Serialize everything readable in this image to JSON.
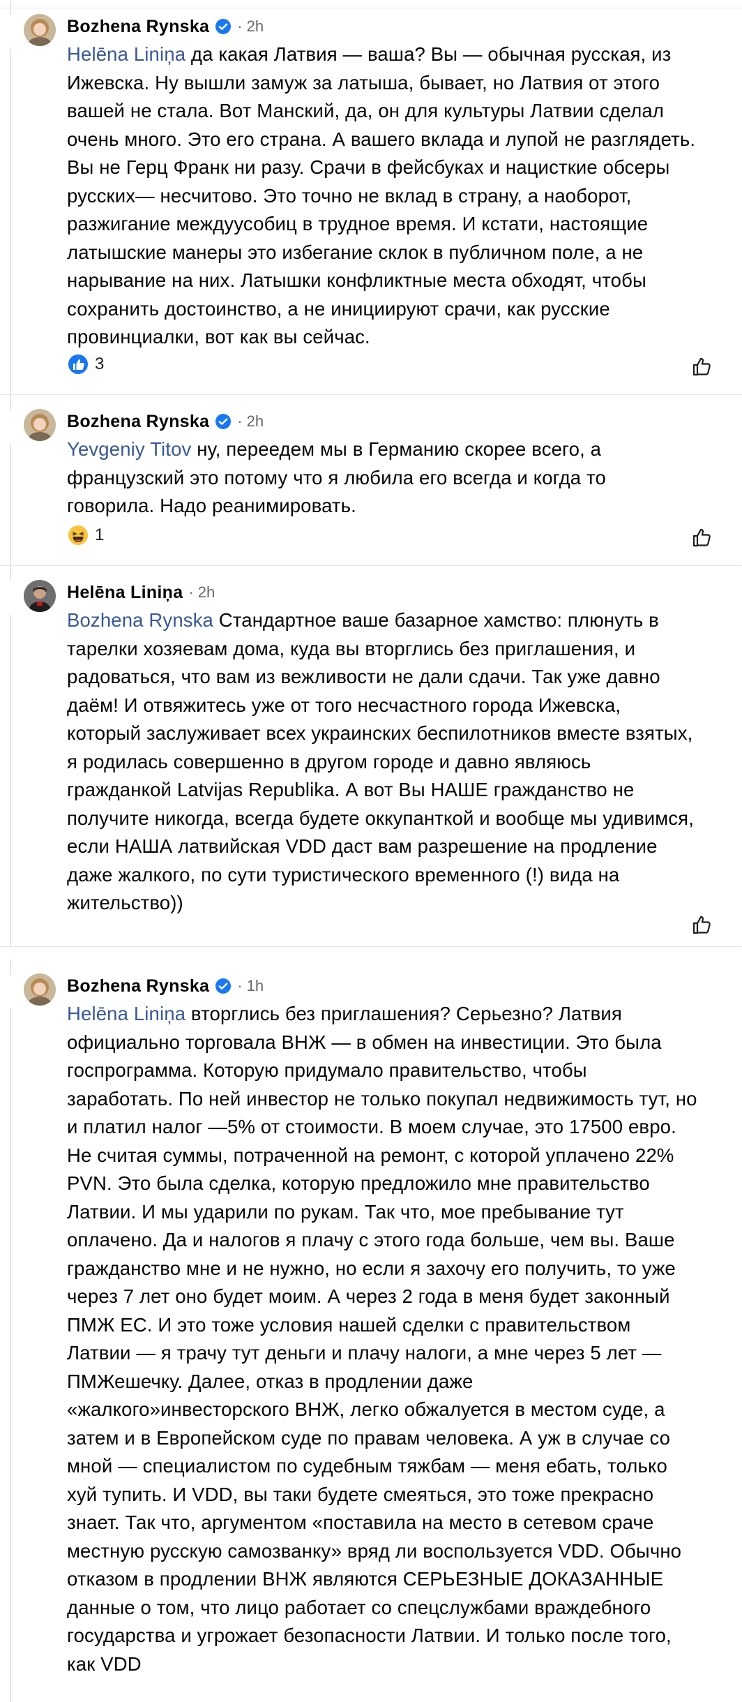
{
  "comments": [
    {
      "author": "Bozhena  Rynska",
      "verified": true,
      "separator": "·",
      "time": "2h",
      "mention": "Helēna Liniņa",
      "text": " да какая Латвия — ваша? Вы — обычная русская, из Ижевска. Ну вышли замуж за латыша, бывает, но Латвия от этого вашей не стала. Вот Манский, да, он для культуры Латвии сделал очень много. Это его страна. А вашего вклада и лупой не разглядеть. Вы не Герц Франк ни разу. Срачи в фейсбуках и нацисткие обсеры русских— несчитово. Это точно не вклад в страну, а наоборот, разжигание междуусобиц в трудное время. И кстати, настоящие латышские манеры это избегание склок в публичном поле, а не нарывание на них. Латышки конфликтные места обходят, чтобы сохранить достоинство, а не инициируют срачи, как русские провинциалки, вот как вы сейчас.",
      "reaction": {
        "icon": "like-reaction-icon",
        "count": "3"
      }
    },
    {
      "author": "Bozhena  Rynska",
      "verified": true,
      "separator": "·",
      "time": "2h",
      "mention": "Yevgeniy Titov",
      "text": " ну, переедем мы в Германию скорее всего, а французский это потому что я любила его всегда и когда то говорила. Надо реанимировать.",
      "reaction": {
        "icon": "haha-reaction-icon",
        "count": "1"
      }
    },
    {
      "author": "Helēna Liniņa",
      "verified": false,
      "separator": "·",
      "time": "2h",
      "mention": "Bozhena  Rynska",
      "text": " Стандартное ваше базарное хамство: плюнуть в тарелки хозяевам дома, куда вы вторглись без приглашения, и радоваться, что вам из вежливости не дали сдачи. Так уже давно даём! И отвяжитесь уже от того несчастного города Ижевска, который заслуживает всех украинских беспилотников вместе взятых, я родилась совершенно в другом городе и давно являюсь гражданкой Latvijas Republika. А вот Вы НАШЕ гражданство не получите никогда, всегда будете оккупанткой и вообще мы  удивимся, если НАША латвийская VDD даст вам разрешение на продление даже жалкого, по сути туристического временного (!) вида на жительство))"
    },
    {
      "author": "Bozhena  Rynska",
      "verified": true,
      "separator": "·",
      "time": "1h",
      "mention": "Helēna Liniņa",
      "text": " вторглись без приглашения? Серьезно? Латвия официально торговала ВНЖ — в обмен на инвестиции. Это была госпрограмма. Которую придумало правительство, чтобы заработать. По ней инвестор не только покупал недвижимость тут, но и платил налог —5% от стоимости. В моем случае, это 17500 евро. Не считая суммы, потраченной на ремонт, с которой уплачено 22% PVN. Это была сделка, которую предложило мне правительство Латвии. И мы ударили по рукам. Так что, мое пребывание тут оплачено. Да и налогов я плачу с этого года больше, чем вы. Ваше гражданство мне и не нужно, но если я захочу его получить, то уже через 7 лет оно будет моим. А через 2 года в меня будет законный ПМЖ ЕС. И это тоже условия нашей сделки с правительством Латвии — я трачу тут деньги и плачу налоги, а мне через 5 лет — ПМЖешечку. Далее, отказ в продлении даже «жалкого»инвесторского ВНЖ, легко обжалуется в местом суде, а затем и в Европейском суде по правам человека. А уж в случае со мной — специалистом по судебным тяжбам — меня ебать, только хуй тупить. И VDD, вы таки будете смеяться, это тоже прекрасно знает. Так что, аргументом «поставила на место в сетевом сраче местную русскую  самозванку» вряд ли воспользуется VDD. Обычно отказом в продлении ВНЖ являются СЕРЬЕЗНЫЕ ДОКАЗАННЫЕ данные о том, что лицо работает со спецслужбами враждебного государства и угрожает безопасности Латвии. И только после того, как VDD"
    }
  ],
  "colors": {
    "mention": "#385898",
    "meta": "#65676b",
    "verified": "#1877f2",
    "divider": "#e4e6eb"
  }
}
